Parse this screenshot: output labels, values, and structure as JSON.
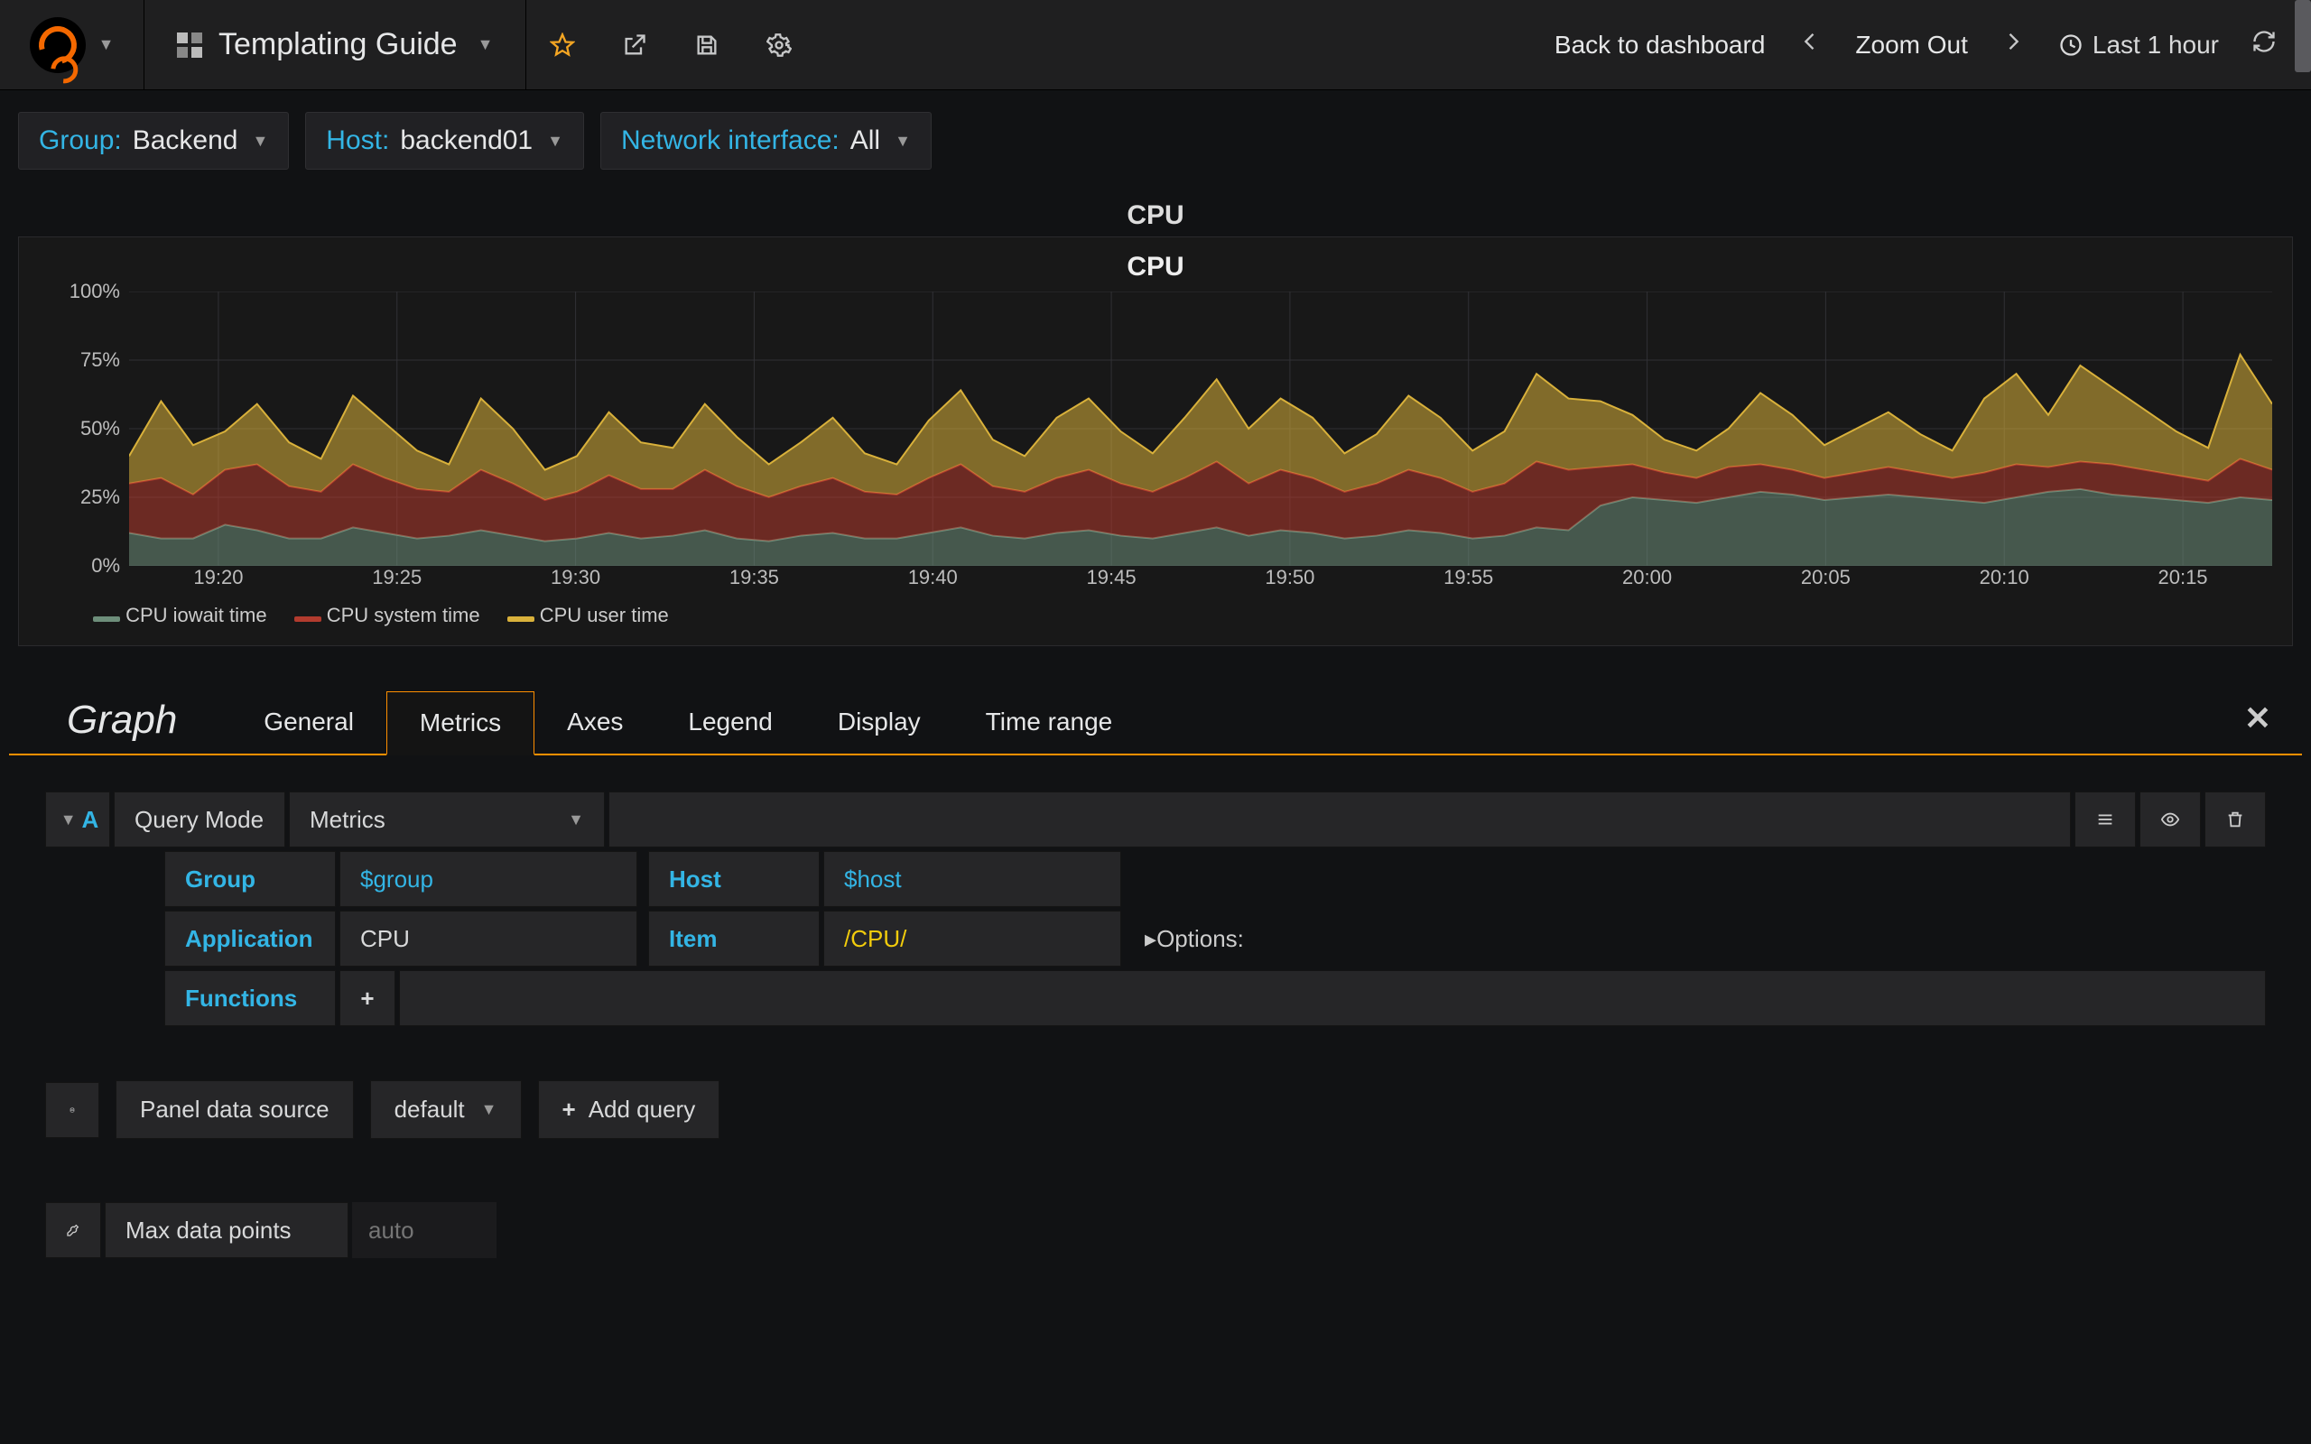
{
  "header": {
    "dashboard_title": "Templating Guide",
    "back_link": "Back to dashboard",
    "zoom_out": "Zoom Out",
    "time_range": "Last 1 hour"
  },
  "variables": [
    {
      "label": "Group:",
      "value": "Backend"
    },
    {
      "label": "Host:",
      "value": "backend01"
    },
    {
      "label": "Network interface:",
      "value": "All"
    }
  ],
  "row_title": "CPU",
  "panel": {
    "title": "CPU",
    "legend": [
      {
        "name": "CPU iowait time",
        "color": "#6d8e7a"
      },
      {
        "name": "CPU system time",
        "color": "#b23b2e"
      },
      {
        "name": "CPU user time",
        "color": "#d9b13b"
      }
    ]
  },
  "chart_data": {
    "type": "area",
    "title": "CPU",
    "ylabel": "%",
    "ylim": [
      0,
      100
    ],
    "yticks": [
      "0%",
      "25%",
      "50%",
      "75%",
      "100%"
    ],
    "x": [
      "19:20",
      "19:25",
      "19:30",
      "19:35",
      "19:40",
      "19:45",
      "19:50",
      "19:55",
      "20:00",
      "20:05",
      "20:10",
      "20:15"
    ],
    "stacked": true,
    "series": [
      {
        "name": "CPU iowait time",
        "color": "#6d8e7a",
        "values": [
          12,
          10,
          10,
          15,
          13,
          10,
          10,
          14,
          12,
          10,
          11,
          13,
          11,
          9,
          10,
          12,
          10,
          11,
          13,
          10,
          9,
          11,
          12,
          10,
          10,
          12,
          14,
          11,
          10,
          12,
          13,
          11,
          10,
          12,
          14,
          11,
          13,
          12,
          10,
          11,
          13,
          12,
          10,
          11,
          14,
          13,
          22,
          25,
          24,
          23,
          25,
          27,
          26,
          24,
          25,
          26,
          25,
          24,
          23,
          25,
          27,
          28,
          26,
          25,
          24,
          23,
          25,
          24
        ]
      },
      {
        "name": "CPU system time",
        "color": "#b23b2e",
        "values": [
          18,
          22,
          16,
          20,
          24,
          19,
          17,
          23,
          20,
          18,
          16,
          22,
          19,
          15,
          17,
          21,
          18,
          17,
          22,
          19,
          16,
          18,
          20,
          17,
          16,
          20,
          23,
          18,
          17,
          20,
          22,
          19,
          17,
          20,
          24,
          19,
          22,
          20,
          17,
          19,
          22,
          20,
          17,
          19,
          24,
          22,
          14,
          12,
          10,
          9,
          11,
          10,
          9,
          8,
          9,
          10,
          9,
          8,
          11,
          12,
          9,
          10,
          11,
          10,
          9,
          8,
          14,
          11
        ]
      },
      {
        "name": "CPU user time",
        "color": "#d9b13b",
        "values": [
          10,
          28,
          18,
          14,
          22,
          16,
          12,
          25,
          20,
          14,
          10,
          26,
          20,
          11,
          13,
          23,
          17,
          15,
          24,
          18,
          12,
          16,
          22,
          14,
          11,
          21,
          27,
          17,
          13,
          22,
          26,
          19,
          14,
          22,
          30,
          20,
          26,
          22,
          14,
          18,
          27,
          22,
          15,
          19,
          32,
          26,
          24,
          18,
          12,
          10,
          14,
          26,
          20,
          12,
          16,
          20,
          14,
          10,
          27,
          33,
          19,
          35,
          28,
          22,
          16,
          12,
          38,
          24
        ]
      }
    ]
  },
  "editor": {
    "type_label": "Graph",
    "tabs": [
      "General",
      "Metrics",
      "Axes",
      "Legend",
      "Display",
      "Time range"
    ],
    "active_tab": "Metrics",
    "query": {
      "ref_id": "A",
      "query_mode_label": "Query Mode",
      "query_mode_value": "Metrics",
      "group_label": "Group",
      "group_value": "$group",
      "host_label": "Host",
      "host_value": "$host",
      "application_label": "Application",
      "application_value": "CPU",
      "item_label": "Item",
      "item_value": "/CPU/",
      "options_label": "Options:",
      "functions_label": "Functions"
    },
    "datasource": {
      "panel_ds_label": "Panel data source",
      "panel_ds_value": "default",
      "add_query_label": "Add query"
    },
    "max_points": {
      "label": "Max data points",
      "placeholder": "auto"
    }
  }
}
